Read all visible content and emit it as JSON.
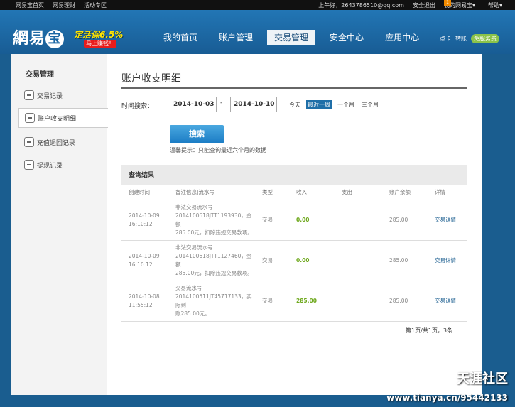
{
  "topbar": {
    "left_links": [
      "网易宝首页",
      "网易理财",
      "活动专区"
    ],
    "time_greeting": "上午好，2643786510@qq.com",
    "logout": "安全退出",
    "my_wallet": "我的网易宝▾",
    "help": "帮助▾",
    "badge": "1"
  },
  "header": {
    "logo_text": "網易",
    "logo_icon": "宝",
    "promo_main": "定活保6.5%",
    "promo_sub": "马上赚钱！",
    "nav": [
      "我的首页",
      "账户管理",
      "交易管理",
      "安全中心",
      "应用中心"
    ],
    "nav_active": 2,
    "right_links": [
      "点卡",
      "转账"
    ],
    "service": "免服务费"
  },
  "sidebar": {
    "title": "交易管理",
    "items": [
      "交易记录",
      "账户收支明细",
      "充值退回记录",
      "提现记录"
    ],
    "active": 1
  },
  "main": {
    "title": "账户收支明细",
    "search_label": "时间搜索：",
    "date_from": "2014-10-03",
    "date_to": "2014-10-10",
    "dash": "-",
    "quick_ranges": [
      "今天",
      "最近一周",
      "一个月",
      "三个月"
    ],
    "quick_selected": 1,
    "search_button": "搜索",
    "tip": "温馨提示：只能查询最近六个月的数据",
    "result_title": "查询结果",
    "columns": [
      "创建时间",
      "备注信息|流水号",
      "类型",
      "收入",
      "支出",
      "账户余额",
      "详情"
    ],
    "rows": [
      {
        "date": "2014-10-09",
        "time": "16:10:12",
        "note_title": "非法交易流水号",
        "note_line2": "2014100618JTT1193930，金额",
        "note_line3": "285.00元，扣除违规交易款项。",
        "type": "交易",
        "income": "0.00",
        "expense": "",
        "balance": "285.00",
        "detail": "交易详情"
      },
      {
        "date": "2014-10-09",
        "time": "16:10:12",
        "note_title": "非法交易流水号",
        "note_line2": "2014100618JTT1127460，金额",
        "note_line3": "285.00元，扣除违规交易款项。",
        "type": "交易",
        "income": "0.00",
        "expense": "",
        "balance": "285.00",
        "detail": "交易详情"
      },
      {
        "date": "2014-10-08",
        "time": "11:55:12",
        "note_title": "交易流水号",
        "note_line2": "2014100511JT45717133，实际到",
        "note_line3": "账285.00元。",
        "type": "交易",
        "income": "285.00",
        "expense": "",
        "balance": "285.00",
        "detail": "交易详情"
      }
    ],
    "pager": "第1页/共1页，3条"
  },
  "watermark": {
    "line1": "天涯社区",
    "line2": "www.tianya.cn/95442133"
  }
}
